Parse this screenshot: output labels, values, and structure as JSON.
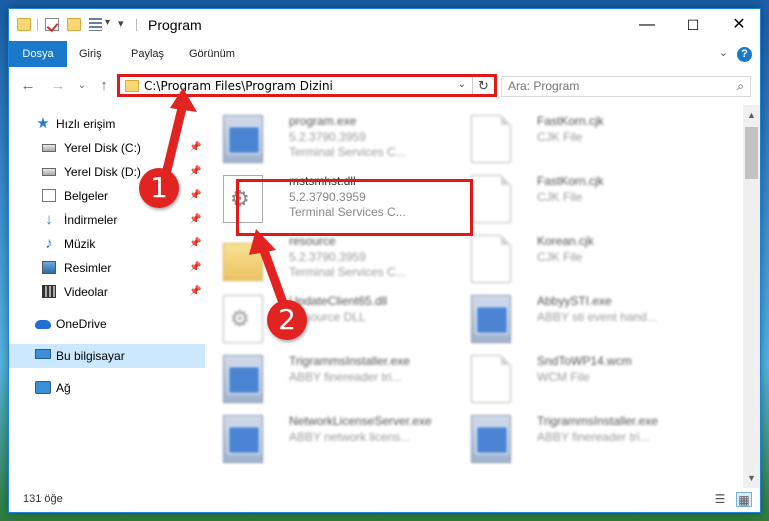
{
  "window": {
    "title": "Program"
  },
  "ribbon": {
    "tabs": [
      "Dosya",
      "Giriş",
      "Paylaş",
      "Görünüm"
    ],
    "help_label": "?"
  },
  "address": {
    "path": "C:\\Program Files\\Program Dizini"
  },
  "search": {
    "placeholder": "Ara: Program"
  },
  "nav": {
    "quick_access": "Hızlı erişim",
    "items": [
      {
        "label": "Yerel Disk (C:)",
        "icon": "drive-icon",
        "pinned": true
      },
      {
        "label": "Yerel Disk (D:)",
        "icon": "drive-icon",
        "pinned": true
      },
      {
        "label": "Belgeler",
        "icon": "documents-icon",
        "pinned": true
      },
      {
        "label": "İndirmeler",
        "icon": "download-icon",
        "pinned": true
      },
      {
        "label": "Müzik",
        "icon": "music-icon",
        "pinned": true
      },
      {
        "label": "Resimler",
        "icon": "pictures-icon",
        "pinned": true
      },
      {
        "label": "Videolar",
        "icon": "videos-icon",
        "pinned": true
      }
    ],
    "onedrive": "OneDrive",
    "this_pc": "Bu bilgisayar",
    "network": "Ağ"
  },
  "files": [
    {
      "name": "program.exe",
      "line1": "5.2.3790.3959",
      "line2": "Terminal Services C...",
      "icon": "exe-icon"
    },
    {
      "name": "FastKorn.cjk",
      "line1": "CJK File",
      "line2": "",
      "icon": "document-icon"
    },
    {
      "name": "mstsmhst.dll",
      "line1": "5.2.3790.3959",
      "line2": "Terminal Services C...",
      "icon": "dll-icon"
    },
    {
      "name": "FastKorn.cjk",
      "line1": "CJK File",
      "line2": "",
      "icon": "document-icon"
    },
    {
      "name": "resource",
      "line1": "5.2.3790.3959",
      "line2": "Terminal Services C...",
      "icon": "folder-icon"
    },
    {
      "name": "Korean.cjk",
      "line1": "CJK File",
      "line2": "",
      "icon": "document-icon"
    },
    {
      "name": "UpdateClient65.dll",
      "line1": "Resource DLL",
      "line2": "",
      "icon": "dll-icon"
    },
    {
      "name": "AbbyySTI.exe",
      "line1": "ABBY sti event hand...",
      "line2": "",
      "icon": "exe-icon"
    },
    {
      "name": "TrigrammsInstaller.exe",
      "line1": "ABBY finereader tri...",
      "line2": "",
      "icon": "exe-icon"
    },
    {
      "name": "SndToWP14.wcm",
      "line1": "WCM File",
      "line2": "",
      "icon": "document-icon"
    },
    {
      "name": "NetworkLicenseServer.exe",
      "line1": "ABBY network licens...",
      "line2": "",
      "icon": "exe-icon"
    },
    {
      "name": "TrigrammsInstaller.exe",
      "line1": "ABBY finereader tri...",
      "line2": "",
      "icon": "exe-icon"
    }
  ],
  "status": {
    "item_count": "131 öğe"
  },
  "callouts": [
    "1",
    "2"
  ],
  "colors": {
    "accent": "#1979ca",
    "highlight_red": "#e11919",
    "badge_red": "#e12322",
    "selection": "#cce8ff"
  }
}
